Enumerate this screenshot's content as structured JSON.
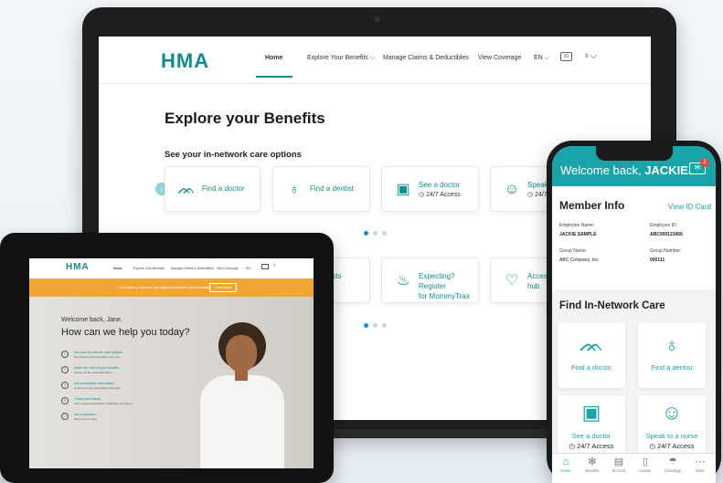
{
  "laptop": {
    "logo": "HMA",
    "nav": [
      "Home",
      "Explore Your Benefits ⌵",
      "Manage Claims & Deductibles",
      "View Coverage",
      "EN ⌵"
    ],
    "icon_box": "ID",
    "user_icon": "♁⌵",
    "heading": "Explore your Benefits",
    "subheading": "See your in-network care options",
    "row1": [
      {
        "label": "Find a doctor",
        "icon": "stethoscope-icon"
      },
      {
        "label": "Find a dentist",
        "icon": "tooth-icon"
      },
      {
        "label": "See a doctor",
        "sub": "24/7 Access",
        "icon": "tablet-icon"
      },
      {
        "label": "Speak to",
        "sub": "24/7 A",
        "icon": "nurse-icon"
      }
    ],
    "row2": [
      {
        "label": "costs\nity",
        "icon": ""
      },
      {
        "label": "Expecting? Register\nfor MommyTrax",
        "icon": "stroller-icon"
      },
      {
        "label": "Access w\nhub",
        "icon": "heartbeat-icon"
      }
    ]
  },
  "tablet": {
    "logo": "HMA",
    "nav": [
      "Home",
      "Explore Your Benefits ⌵",
      "Manage Claims & Deductibles",
      "View Coverage",
      "EN ⌵"
    ],
    "banner_text": "Download or access to your digital identification card information",
    "banner_button": "Learn More",
    "welcome": "Welcome back, Jane.",
    "headline": "How can we help you today?",
    "items": [
      {
        "title": "See your in-network care options",
        "sub": "Find doctors and specialists near you"
      },
      {
        "title": "Make the most of your benefits",
        "sub": "Explore all the perks and offers"
      },
      {
        "title": "Get prescription information",
        "sub": "Connect to your prescription drug plan"
      },
      {
        "title": "Check your spend",
        "sub": "View medical deductibles, HSA/FSA, and claims"
      },
      {
        "title": "Ask a question",
        "sub": "We're here to help"
      }
    ]
  },
  "phone": {
    "welcome_prefix": "Welcome back, ",
    "welcome_name": "JACKIE.",
    "badge": "2",
    "member_title": "Member Info",
    "view_id": "View ID Card",
    "employee_name_label": "Employee Name:",
    "employee_name": "JACKIE SAMPLE",
    "employee_id_label": "Employee ID:",
    "employee_id": "ABC000123456",
    "group_name_label": "Group Name:",
    "group_name": "ABC Company, Inc.",
    "group_number_label": "Group Number:",
    "group_number": "000111",
    "find_title": "Find In-Network Care",
    "cards": [
      {
        "label": "Find a doctor",
        "icon": "stethoscope-icon"
      },
      {
        "label": "Find a dentist",
        "icon": "tooth-icon"
      },
      {
        "label": "See a doctor",
        "sub": "24/7 Access",
        "icon": "tablet-icon"
      },
      {
        "label": "Speak to a nurse",
        "sub": "24/7 Access",
        "icon": "nurse-icon"
      }
    ],
    "tabs": [
      "Home",
      "Benefits",
      "ID Card",
      "Claims",
      "Coverage",
      "More"
    ]
  }
}
